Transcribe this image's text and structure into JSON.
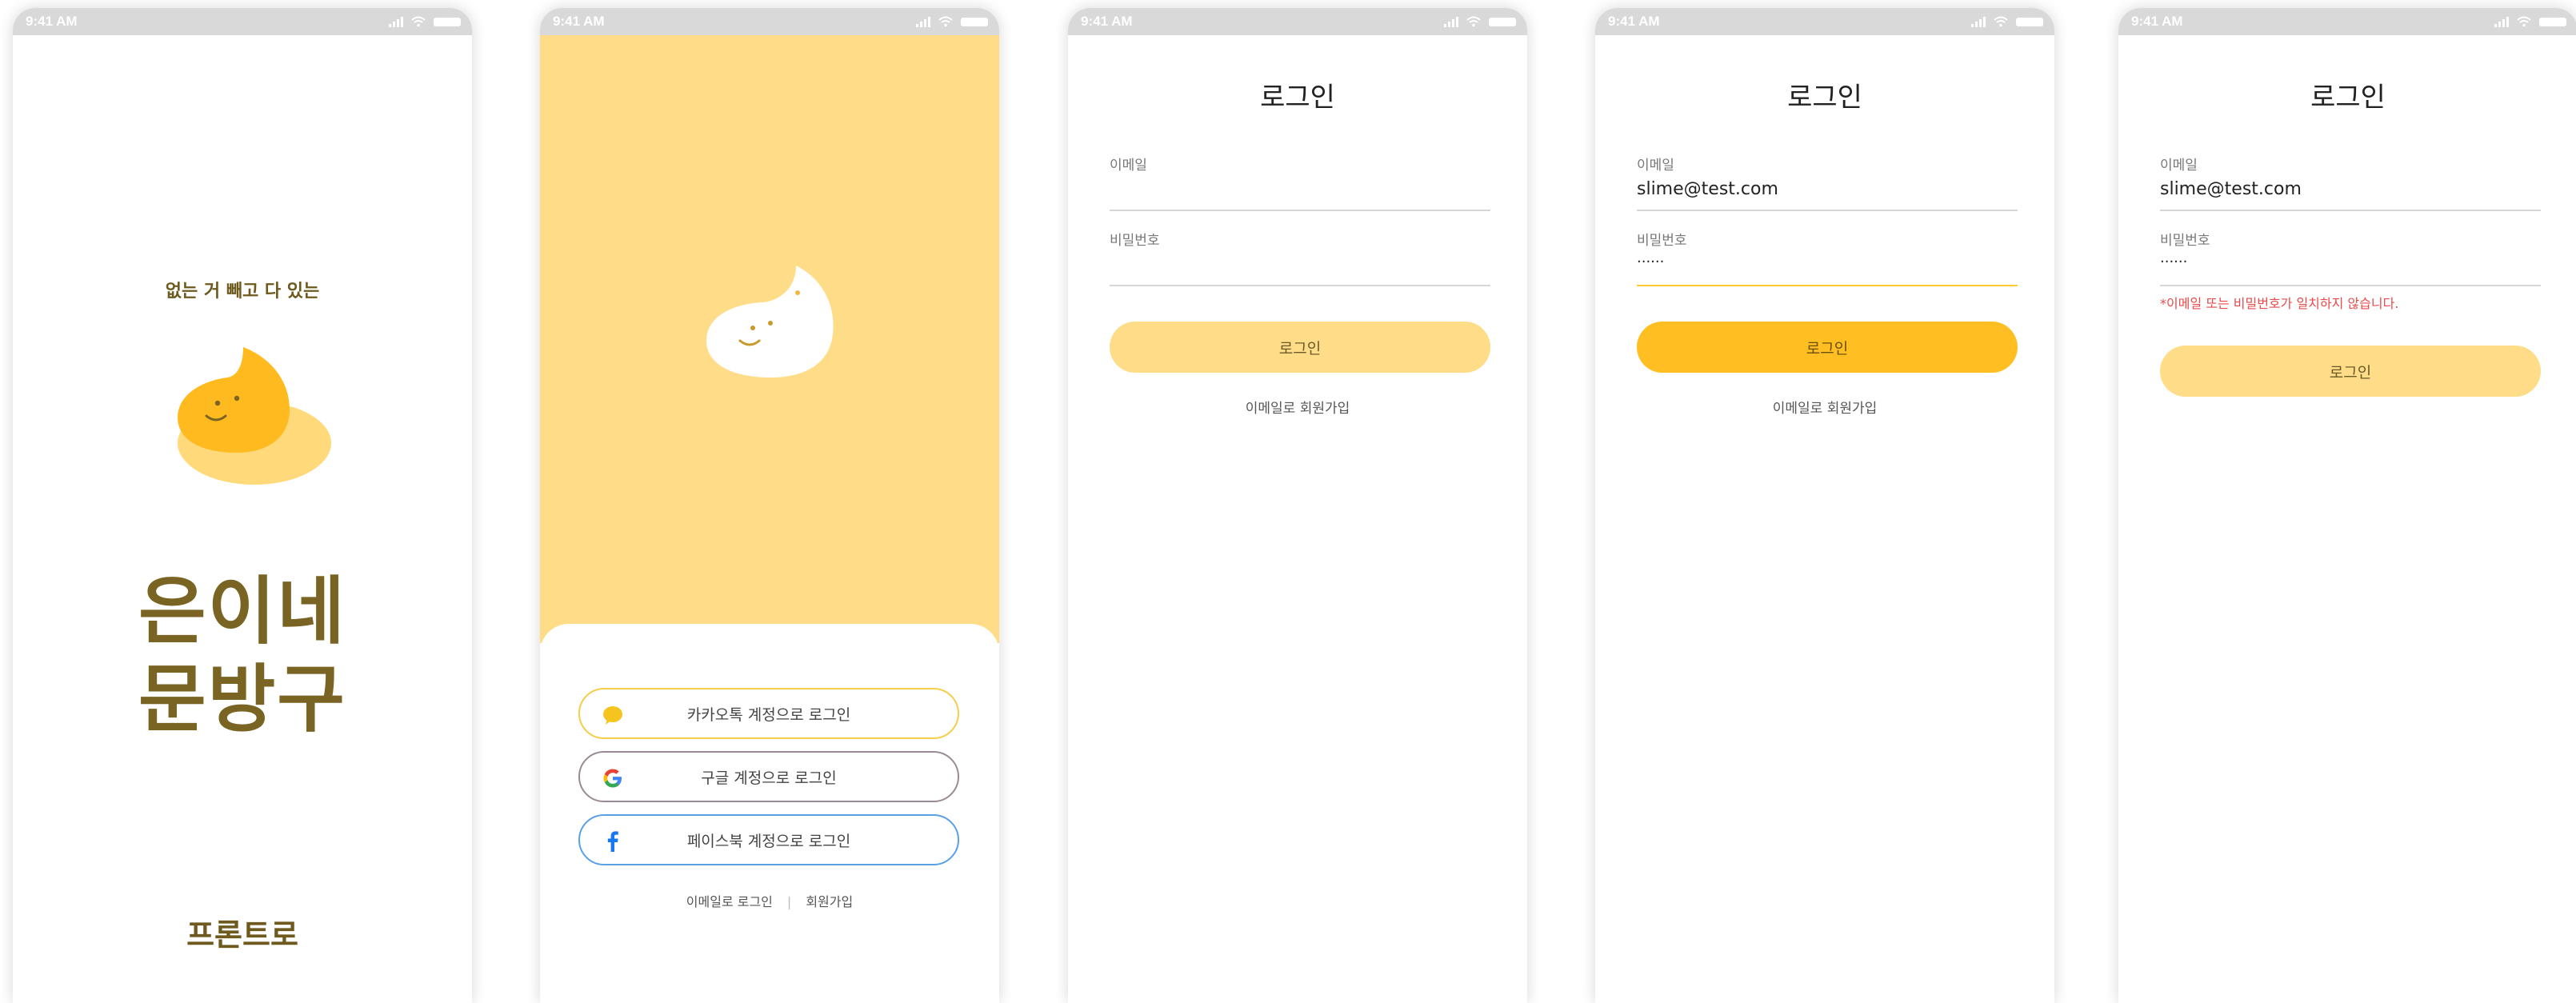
{
  "status_bar": {
    "time": "9:41 AM"
  },
  "colors": {
    "accent": "#ffbf23",
    "accent_light": "#ffdd88",
    "brand_text": "#7a6424",
    "error": "#ea4a4a",
    "kakao": "#f5c41f",
    "facebook": "#1877f2"
  },
  "splash": {
    "tagline": "없는 거 빼고 다 있는",
    "brand_line1": "은이네",
    "brand_line2": "문방구",
    "footer": "프론트로"
  },
  "social_login": {
    "kakao_label": "카카오톡 계정으로 로그인",
    "google_label": "구글 계정으로 로그인",
    "facebook_label": "페이스북 계정으로 로그인",
    "email_login_link": "이메일로 로그인",
    "separator": "|",
    "signup_link": "회원가입"
  },
  "login_empty": {
    "title": "로그인",
    "email_label": "이메일",
    "password_label": "비밀번호",
    "login_button": "로그인",
    "signup_link": "이메일로 회원가입"
  },
  "login_filled": {
    "title": "로그인",
    "email_label": "이메일",
    "email_value": "slime@test.com",
    "password_label": "비밀번호",
    "password_value": "......",
    "login_button": "로그인",
    "signup_link": "이메일로 회원가입"
  },
  "login_error": {
    "title": "로그인",
    "email_label": "이메일",
    "email_value": "slime@test.com",
    "password_label": "비밀번호",
    "password_value": "......",
    "error_message": "*이메일 또는 비밀번호가 일치하지 않습니다.",
    "login_button": "로그인"
  }
}
